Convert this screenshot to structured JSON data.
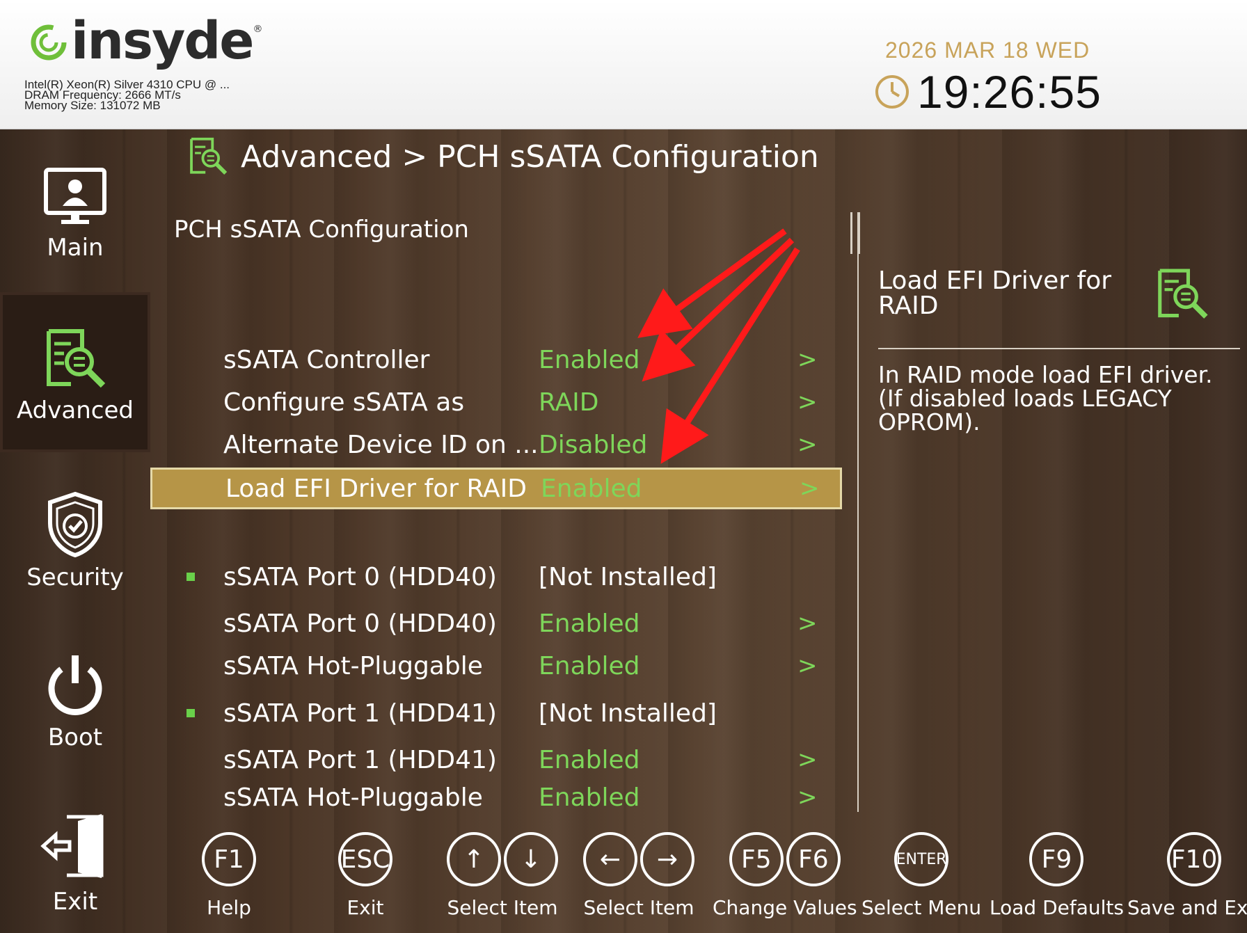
{
  "header": {
    "logo_text": "insyde",
    "cpu": "Intel(R) Xeon(R) Silver 4310 CPU @ ...",
    "dram": "DRAM Frequency: 2666 MT/s",
    "memory": "Memory Size: 131072 MB",
    "date": "2026 MAR 18 WED",
    "time": "19:26:55"
  },
  "nav": {
    "items": [
      {
        "label": "Main",
        "icon": "monitor-user-icon"
      },
      {
        "label": "Advanced",
        "icon": "advanced-search-icon",
        "active": true
      },
      {
        "label": "Security",
        "icon": "shield-icon"
      },
      {
        "label": "Boot",
        "icon": "power-icon"
      },
      {
        "label": "Exit",
        "icon": "exit-door-icon"
      }
    ]
  },
  "breadcrumb": "Advanced > PCH sSATA Configuration",
  "section_title": "PCH sSATA Configuration",
  "settings": [
    {
      "label": "sSATA Controller",
      "value": "Enabled",
      "has_arrow": true
    },
    {
      "label": "Configure sSATA as",
      "value": "RAID",
      "has_arrow": true
    },
    {
      "label": "Alternate Device ID on ...",
      "value": "Disabled",
      "has_arrow": true
    },
    {
      "label": "Load EFI Driver for RAID",
      "value": "Enabled",
      "has_arrow": true,
      "selected": true
    },
    {
      "label": "sSATA Port 0 (HDD40)",
      "value": "[Not Installed]",
      "bullet": true
    },
    {
      "label": "sSATA Port 0 (HDD40)",
      "value": "Enabled",
      "has_arrow": true
    },
    {
      "label": "sSATA Hot-Pluggable",
      "value": "Enabled",
      "has_arrow": true
    },
    {
      "label": "sSATA Port 1 (HDD41)",
      "value": "[Not Installed]",
      "bullet": true
    },
    {
      "label": "sSATA Port 1 (HDD41)",
      "value": "Enabled",
      "has_arrow": true
    },
    {
      "label": "sSATA Hot-Pluggable",
      "value": "Enabled",
      "has_arrow": true
    }
  ],
  "arrow_glyph": ">",
  "help": {
    "title": "Load EFI Driver for RAID",
    "text": "In RAID mode load EFI driver. (If disabled loads LEGACY OPROM)."
  },
  "keys": [
    {
      "keys": [
        "F1"
      ],
      "label": "Help"
    },
    {
      "keys": [
        "ESC"
      ],
      "label": "Exit"
    },
    {
      "keys": [
        "↑",
        "↓"
      ],
      "label": "Select Item"
    },
    {
      "keys": [
        "←",
        "→"
      ],
      "label": "Select Item"
    },
    {
      "keys": [
        "F5",
        "F6"
      ],
      "label": "Change Values"
    },
    {
      "keys": [
        "ENTER"
      ],
      "label": "Select Menu"
    },
    {
      "keys": [
        "F9"
      ],
      "label": "Load Defaults"
    },
    {
      "keys": [
        "F10"
      ],
      "label": "Save and Exit"
    }
  ],
  "colors": {
    "accent_green": "#7ed65a",
    "highlight_gold": "#b69547",
    "date_gold": "#c8a35a",
    "annotation_red": "#ff1a1a"
  }
}
